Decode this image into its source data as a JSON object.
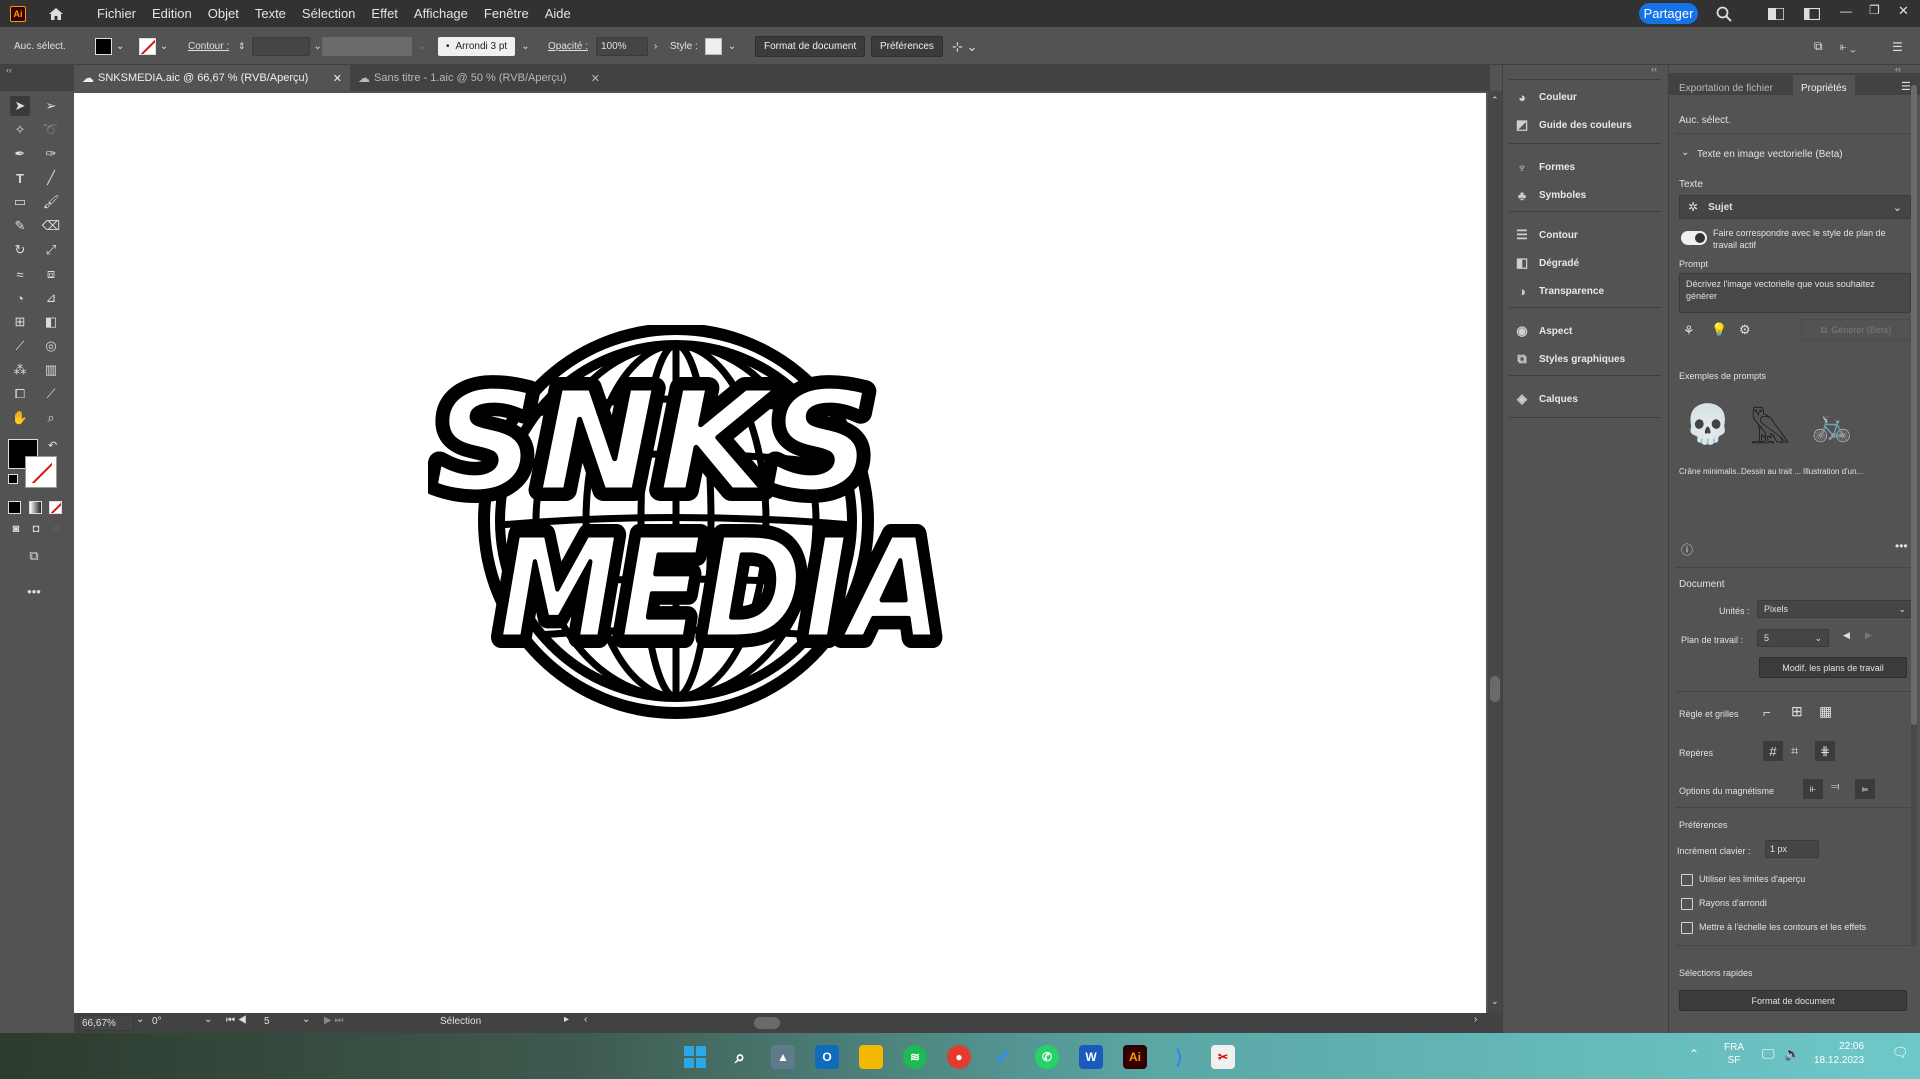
{
  "app": {
    "logo_text": "Ai",
    "share_label": "Partager"
  },
  "menu": [
    "Fichier",
    "Edition",
    "Objet",
    "Texte",
    "Sélection",
    "Effet",
    "Affichage",
    "Fenêtre",
    "Aide"
  ],
  "control": {
    "selection": "Auc. sélect.",
    "contour_label": "Contour :",
    "brush": "Arrondi 3 pt",
    "opacity_label": "Opacité :",
    "opacity_value": "100%",
    "style_label": "Style :",
    "doc_format_button": "Format de document",
    "prefs_button": "Préférences"
  },
  "tabs": [
    {
      "label": "SNKSMEDIA.aic @ 66,67 % (RVB/Aperçu)",
      "active": true
    },
    {
      "label": "Sans titre - 1.aic @ 50 % (RVB/Aperçu)",
      "active": false
    }
  ],
  "logo": {
    "line1": "SNKS",
    "line2": "MEDIA"
  },
  "status": {
    "zoom": "66,67%",
    "rotation": "0°",
    "artboard": "5",
    "tool": "Sélection"
  },
  "panels": [
    "Couleur",
    "Guide des couleurs",
    "Formes",
    "Symboles",
    "Contour",
    "Dégradé",
    "Transparence",
    "Aspect",
    "Styles graphiques",
    "Calques"
  ],
  "properties": {
    "tab_export": "Exportation de fichier",
    "tab_props": "Propriétés",
    "no_selection": "Auc. sélect.",
    "section_text_to_vector": "Texte en image vectorielle (Beta)",
    "texte_label": "Texte",
    "subject_value": "Sujet",
    "match_style": "Faire correspondre avec le style de plan de travail actif",
    "prompt_label": "Prompt",
    "prompt_placeholder": "Décrivez l'image vectorielle que vous souhaitez générer",
    "generate_button": "Générer (Beta)",
    "examples_label": "Exemples de prompts",
    "examples": [
      "Crâne minimalis...",
      "Dessin au trait ...",
      "Illustration d'un..."
    ],
    "document_label": "Document",
    "units_label": "Unités :",
    "units_value": "Pixels",
    "artboard_label": "Plan de travail :",
    "artboard_value": "5",
    "edit_artboards_button": "Modif. les plans de travail",
    "rulers_label": "Règle et grilles",
    "guides_label": "Repères",
    "snap_label": "Options du magnétisme",
    "prefs_label": "Préférences",
    "key_increment_label": "Incrément clavier :",
    "key_increment_value": "1 px",
    "opt1": "Utiliser les limites d'aperçu",
    "opt2": "Rayons d'arrondi",
    "opt3": "Mettre à l'échelle les contours et les effets",
    "quick_label": "Sélections rapides",
    "quick_button": "Format de document"
  },
  "taskbar": {
    "lang1": "FRA",
    "lang2": "SF",
    "time": "22:06",
    "date": "18.12.2023"
  }
}
